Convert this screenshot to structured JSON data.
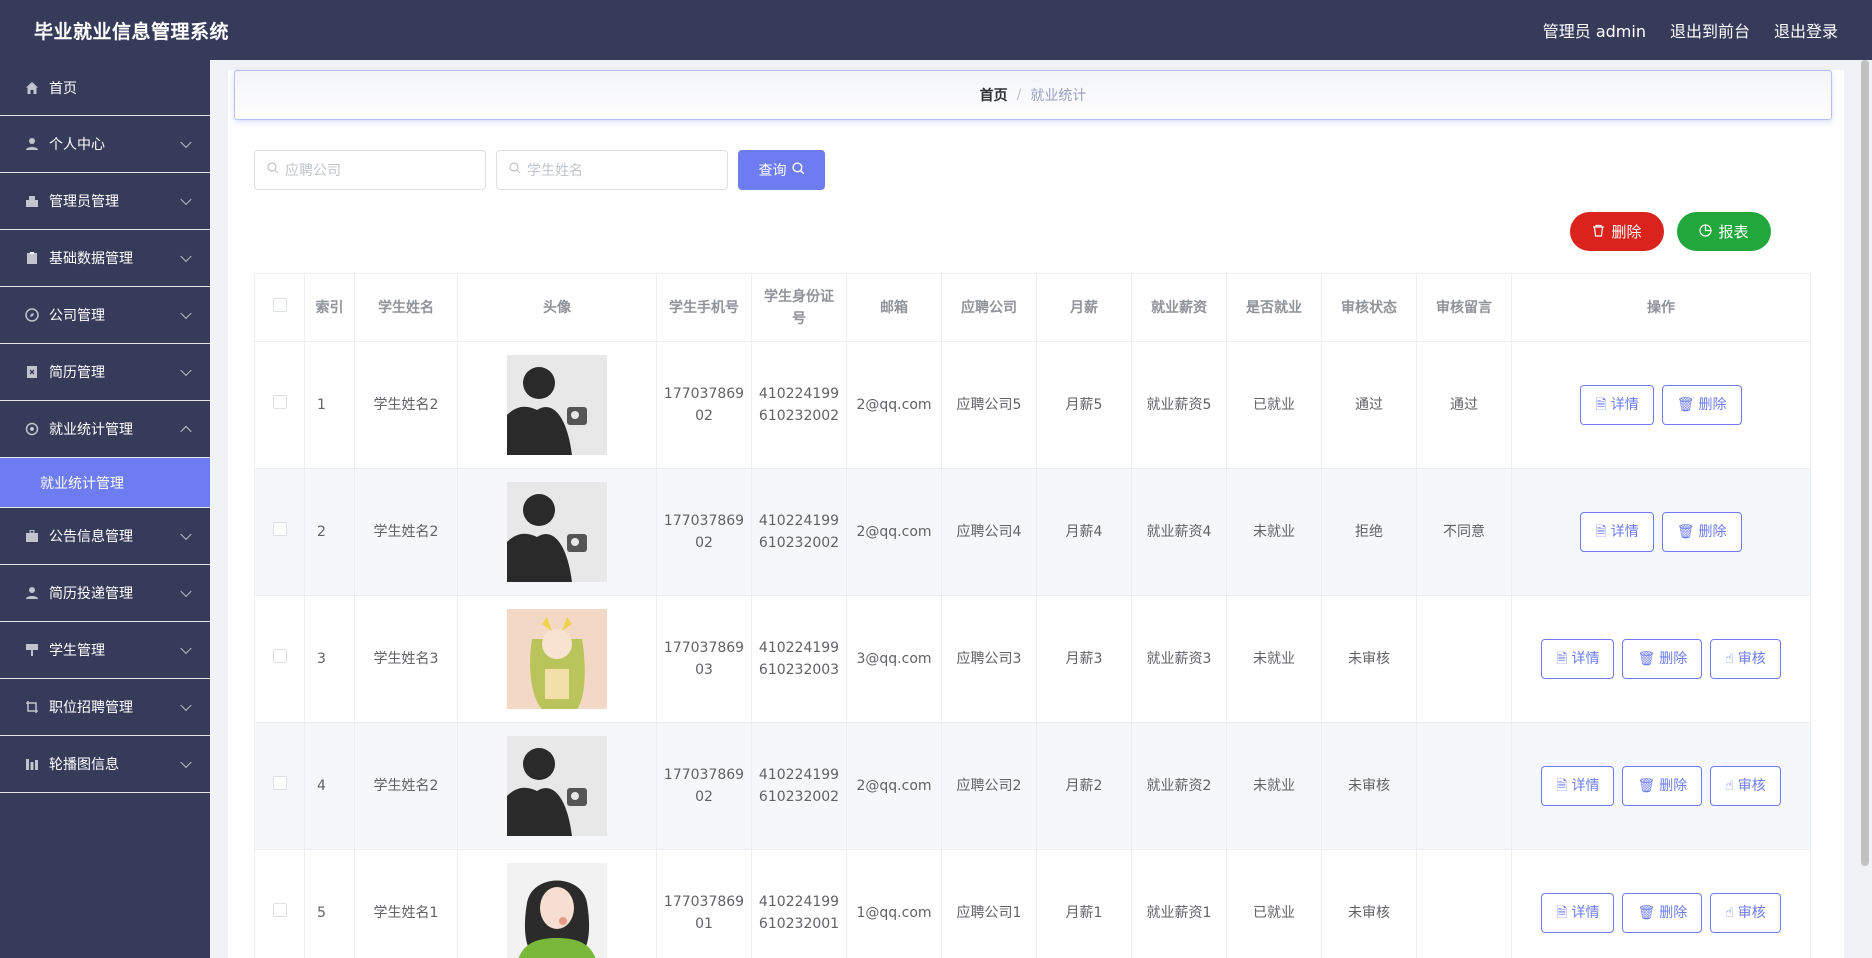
{
  "header": {
    "title": "毕业就业信息管理系统",
    "user_label": "管理员 admin",
    "to_front": "退出到前台",
    "logout": "退出登录"
  },
  "sidebar": {
    "home": "首页",
    "items": [
      {
        "label": "个人中心",
        "icon": "user-icon"
      },
      {
        "label": "管理员管理",
        "icon": "admin-icon"
      },
      {
        "label": "基础数据管理",
        "icon": "clipboard-icon"
      },
      {
        "label": "公司管理",
        "icon": "compass-icon"
      },
      {
        "label": "简历管理",
        "icon": "document-x-icon"
      },
      {
        "label": "就业统计管理",
        "icon": "gear-icon"
      },
      {
        "label": "公告信息管理",
        "icon": "briefcase-icon"
      },
      {
        "label": "简历投递管理",
        "icon": "user-icon"
      },
      {
        "label": "学生管理",
        "icon": "brush-icon"
      },
      {
        "label": "职位招聘管理",
        "icon": "crop-icon"
      },
      {
        "label": "轮播图信息",
        "icon": "chart-bars-icon"
      }
    ],
    "active_sub": "就业统计管理"
  },
  "breadcrumb": {
    "home": "首页",
    "sep": "/",
    "current": "就业统计"
  },
  "search": {
    "company_placeholder": "应聘公司",
    "student_placeholder": "学生姓名",
    "query_label": "查询"
  },
  "actions": {
    "delete_label": "删除",
    "report_label": "报表"
  },
  "table": {
    "headers": {
      "index": "索引",
      "name": "学生姓名",
      "avatar": "头像",
      "phone": "学生手机号",
      "idcard_1": "学生身份证",
      "idcard_2": "号",
      "email": "邮箱",
      "company": "应聘公司",
      "salary": "月薪",
      "emp_salary": "就业薪资",
      "employed": "是否就业",
      "status": "审核状态",
      "remark": "审核留言",
      "ops": "操作"
    },
    "rows": [
      {
        "index": "1",
        "name": "学生姓名2",
        "phone_1": "177037869",
        "phone_2": "02",
        "id_1": "410224199",
        "id_2": "610232002",
        "email": "2@qq.com",
        "company": "应聘公司5",
        "salary": "月薪5",
        "emp_salary": "就业薪资5",
        "employed": "已就业",
        "status": "通过",
        "remark": "通过"
      },
      {
        "index": "2",
        "name": "学生姓名2",
        "phone_1": "177037869",
        "phone_2": "02",
        "id_1": "410224199",
        "id_2": "610232002",
        "email": "2@qq.com",
        "company": "应聘公司4",
        "salary": "月薪4",
        "emp_salary": "就业薪资4",
        "employed": "未就业",
        "status": "拒绝",
        "remark": "不同意"
      },
      {
        "index": "3",
        "name": "学生姓名3",
        "phone_1": "177037869",
        "phone_2": "03",
        "id_1": "410224199",
        "id_2": "610232003",
        "email": "3@qq.com",
        "company": "应聘公司3",
        "salary": "月薪3",
        "emp_salary": "就业薪资3",
        "employed": "未就业",
        "status": "未审核",
        "remark": ""
      },
      {
        "index": "4",
        "name": "学生姓名2",
        "phone_1": "177037869",
        "phone_2": "02",
        "id_1": "410224199",
        "id_2": "610232002",
        "email": "2@qq.com",
        "company": "应聘公司2",
        "salary": "月薪2",
        "emp_salary": "就业薪资2",
        "employed": "未就业",
        "status": "未审核",
        "remark": ""
      },
      {
        "index": "5",
        "name": "学生姓名1",
        "phone_1": "177037869",
        "phone_2": "01",
        "id_1": "410224199",
        "id_2": "610232001",
        "email": "1@qq.com",
        "company": "应聘公司1",
        "salary": "月薪1",
        "emp_salary": "就业薪资1",
        "employed": "已就业",
        "status": "未审核",
        "remark": ""
      }
    ],
    "ops": {
      "detail": "详情",
      "delete": "删除",
      "review": "审核"
    }
  },
  "colors": {
    "primary": "#6d7cf0",
    "sidebar_bg": "#373b5a",
    "danger": "#d9231c",
    "success": "#22a73c"
  }
}
